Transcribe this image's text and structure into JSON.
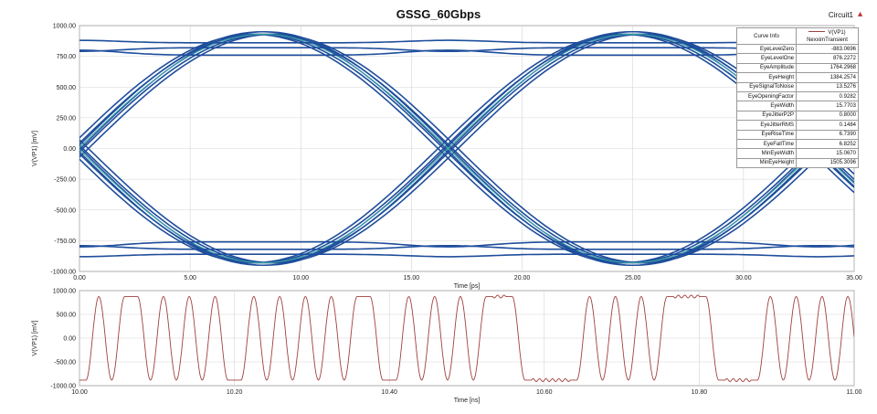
{
  "header": {
    "title": "GSSG_60Gbps",
    "circuit_label": "Circuit1"
  },
  "info_table": {
    "header_key": "Curve Info",
    "legend_name": "V(VP1)",
    "legend_sub": "NexximTransient",
    "rows": [
      {
        "key": "EyeLevelZero",
        "value": "-883.0696"
      },
      {
        "key": "EyeLevelOne",
        "value": "876.2272"
      },
      {
        "key": "EyeAmplitude",
        "value": "1764.2968"
      },
      {
        "key": "EyeHeight",
        "value": "1384.2574"
      },
      {
        "key": "EyeSignalToNoise",
        "value": "13.5276"
      },
      {
        "key": "EyeOpeningFactor",
        "value": "0.9282"
      },
      {
        "key": "EyeWidth",
        "value": "15.7703"
      },
      {
        "key": "EyeJitterP2P",
        "value": "0.8000"
      },
      {
        "key": "EyeJitterRMS",
        "value": "0.1484"
      },
      {
        "key": "EyeRiseTime",
        "value": "6.7390"
      },
      {
        "key": "EyeFallTime",
        "value": "6.8252"
      },
      {
        "key": "MinEyeWidth",
        "value": "15.0670"
      },
      {
        "key": "MinEyeHeight",
        "value": "1505.3096"
      }
    ]
  },
  "chart_data": [
    {
      "type": "line",
      "name": "eye-diagram",
      "title": "GSSG_60Gbps",
      "xlabel": "Time [ps]",
      "ylabel": "V(VP1) [mV]",
      "xlim": [
        0,
        35
      ],
      "ylim": [
        -1000,
        1000
      ],
      "xticks": [
        "0.00",
        "5.00",
        "10.00",
        "15.00",
        "20.00",
        "25.00",
        "30.00",
        "35.00"
      ],
      "yticks": [
        "1000.00",
        "750.00",
        "500.00",
        "250.00",
        "0.00",
        "-250.00",
        "-500.00",
        "-750.00",
        "-1000.00"
      ],
      "grid": true,
      "unit_interval_ps": 16.67,
      "crossing_points_ps": [
        8.3,
        25.0
      ],
      "crossing_level_mV": 0,
      "level_one_mV": 876,
      "level_zero_mV": -883,
      "colors": {
        "trace": "#1f4e9c",
        "highlight": "#3aa6a8"
      }
    },
    {
      "type": "line",
      "name": "transient-waveform",
      "xlabel": "Time [ns]",
      "ylabel": "V(VP1) [mV]",
      "xlim": [
        10.0,
        11.0
      ],
      "ylim": [
        -1000,
        1000
      ],
      "xticks": [
        "10.00",
        "10.20",
        "10.40",
        "10.60",
        "10.80",
        "11.00"
      ],
      "yticks": [
        "1000.00",
        "500.00",
        "0.00",
        "-500.00",
        "-1000.00"
      ],
      "grid": true,
      "bit_period_ns": 0.01667,
      "level_one_mV": 876,
      "level_zero_mV": -883,
      "bits": "0101101010100101010101100101010111000001010101111000010101010101",
      "colors": {
        "trace": "#a0403d"
      }
    }
  ]
}
